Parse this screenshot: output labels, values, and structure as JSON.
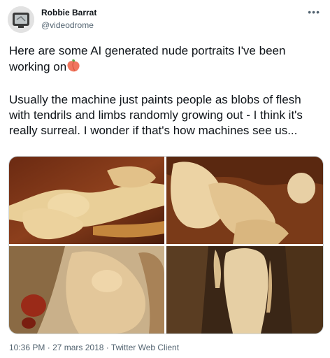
{
  "tweet": {
    "author_name": "Robbie Barrat",
    "author_handle": "@videodrome",
    "more_icon": "more-horizontal-icon",
    "paragraph_1": "Here are some AI generated nude portraits I've been working on",
    "paragraph_1_emoji": "peach-emoji",
    "paragraph_2": "Usually the machine just paints people as blobs of flesh with tendrils and limbs randomly growing out - I think it's really surreal. I wonder if that's how machines see us...",
    "time": "10:36 PM",
    "date": "27 mars 2018",
    "source": "Twitter Web Client",
    "separator": "·"
  },
  "colors": {
    "text_primary": "#0f1419",
    "text_secondary": "#536471",
    "border": "#cfd9de",
    "peach": "#f0765e"
  }
}
